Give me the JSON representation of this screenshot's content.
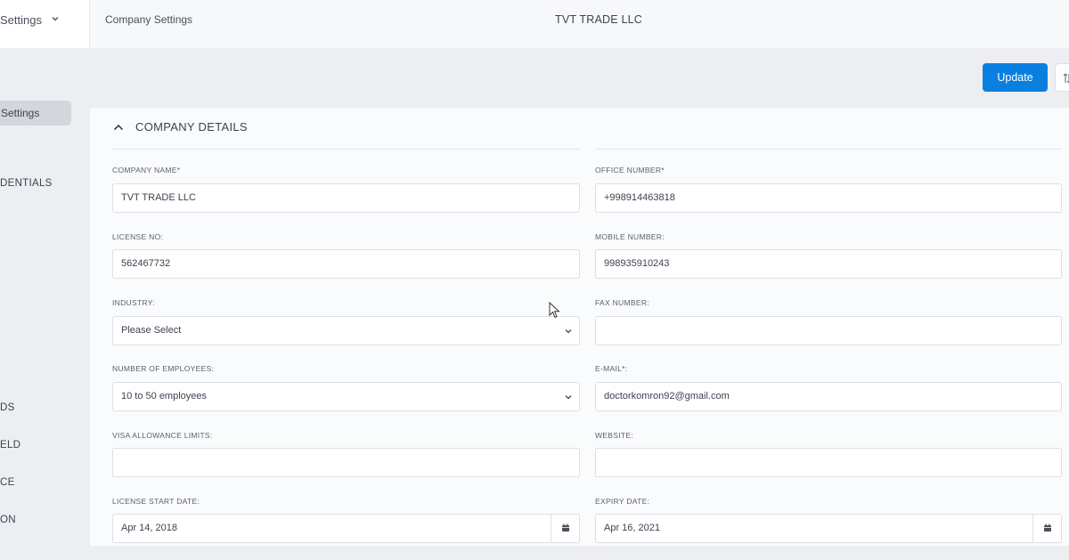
{
  "topbar": {
    "menu_label": "Settings",
    "breadcrumb": "Company Settings",
    "company_name": "TVT TRADE LLC"
  },
  "sidebar": {
    "items": [
      {
        "label": "Settings",
        "active": true
      },
      {
        "label": "DENTIALS"
      },
      {
        "label": "DS"
      },
      {
        "label": "ELD"
      },
      {
        "label": "CE"
      },
      {
        "label": "ON"
      }
    ]
  },
  "toolbar": {
    "update_label": "Update"
  },
  "section": {
    "title": "COMPANY DETAILS"
  },
  "form": {
    "company_name": {
      "label": "COMPANY NAME*",
      "value": "TVT TRADE LLC"
    },
    "office_number": {
      "label": "OFFICE NUMBER*",
      "value": "+998914463818"
    },
    "license_no": {
      "label": "LICENSE NO:",
      "value": "562467732"
    },
    "mobile_number": {
      "label": "MOBILE NUMBER:",
      "value": "998935910243"
    },
    "industry": {
      "label": "INDUSTRY:",
      "value": "Please Select"
    },
    "fax_number": {
      "label": "FAX NUMBER:",
      "value": ""
    },
    "employees": {
      "label": "NUMBER OF EMPLOYEES:",
      "value": "10 to 50 employees"
    },
    "email": {
      "label": "E-MAIL*:",
      "value": "doctorkomron92@gmail.com"
    },
    "visa_allowance": {
      "label": "VISA ALLOWANCE LIMITS:",
      "value": ""
    },
    "website": {
      "label": "WEBSITE:",
      "value": ""
    },
    "license_start": {
      "label": "LICENSE START DATE:",
      "value": "Apr 14, 2018"
    },
    "expiry_date": {
      "label": "EXPIRY DATE:",
      "value": "Apr 16, 2021"
    }
  },
  "colors": {
    "accent": "#0a7fe0",
    "page_bg": "#eceef2",
    "card_bg": "#fafbfc"
  }
}
